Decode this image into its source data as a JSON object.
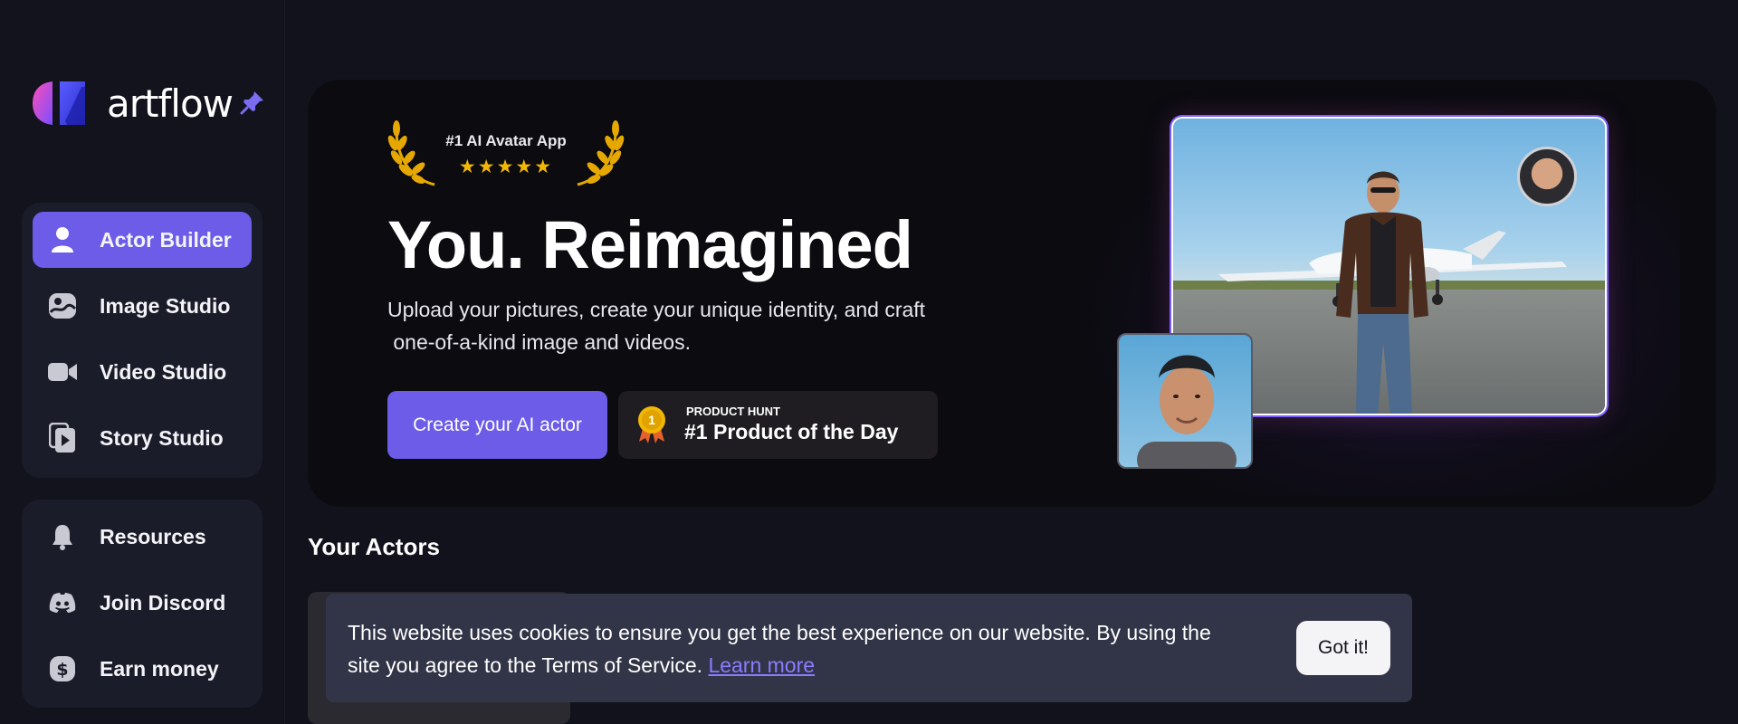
{
  "brand": {
    "name_light": "art",
    "name_bold": "flow",
    "accent": "#6c5ce7"
  },
  "sidebar": {
    "main_items": [
      {
        "label": "Actor Builder",
        "icon": "user-icon",
        "active": true
      },
      {
        "label": "Image Studio",
        "icon": "image-icon",
        "active": false
      },
      {
        "label": "Video Studio",
        "icon": "video-camera-icon",
        "active": false
      },
      {
        "label": "Story Studio",
        "icon": "story-play-icon",
        "active": false
      }
    ],
    "secondary_items": [
      {
        "label": "Resources",
        "icon": "bell-icon"
      },
      {
        "label": "Join Discord",
        "icon": "discord-icon"
      },
      {
        "label": "Earn money",
        "icon": "dollar-icon"
      }
    ]
  },
  "hero": {
    "award_text": "#1 AI Avatar App",
    "award_stars": "★★★★★",
    "title": "You. Reimagined",
    "description_line1": "Upload your pictures, create your unique identity, and craft",
    "description_line2": " one-of-a-kind image and videos.",
    "cta_label": "Create your AI actor",
    "product_hunt": {
      "medal": "1",
      "small": "PRODUCT HUNT",
      "big": "#1 Product of the Day"
    }
  },
  "section": {
    "title": "Your Actors"
  },
  "cookie": {
    "text": "This website uses cookies to ensure you get the best experience on our website. By using the site you agree to the Terms of Service. ",
    "link": "Learn more",
    "button": "Got it!"
  }
}
